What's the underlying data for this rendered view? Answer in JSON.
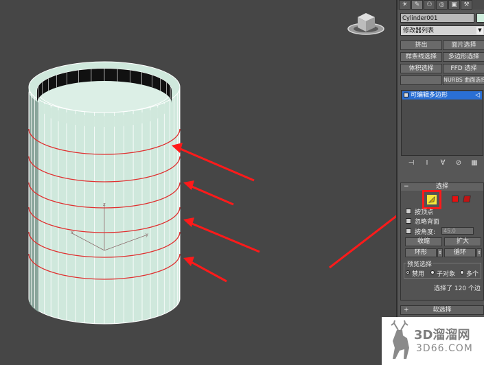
{
  "colors": {
    "viewport_bg": "#464646",
    "mesh": "#cfe8dc",
    "mesh_edges": "#ffffff",
    "selected_edge": "#e03030",
    "arrow": "#ff1a1a",
    "stack_highlight": "#2a6fd4"
  },
  "command_panel": {
    "tabs": [
      {
        "icon": "sun-icon"
      },
      {
        "icon": "modify-brush-icon"
      },
      {
        "icon": "hierarchy-icon"
      },
      {
        "icon": "motion-icon"
      },
      {
        "icon": "display-icon"
      },
      {
        "icon": "utilities-icon"
      }
    ],
    "object_name": "Cylinder001",
    "modifier_list_label": "修改器列表",
    "modifier_buttons": [
      "挤出",
      "面片选择",
      "样条线选择",
      "多边形选择",
      "体积选择",
      "FFD 选择",
      "",
      "NURBS 曲面选择"
    ],
    "stack_item": "可编辑多边形"
  },
  "selection_rollout": {
    "title": "选择",
    "by_vertex": "按顶点",
    "ignore_backfacing": "忽略背面",
    "by_angle": "按角度:",
    "angle_value": "45.0",
    "shrink": "收缩",
    "grow": "扩大",
    "ring": "环形",
    "loop": "循环",
    "preview_group": "预览选择",
    "preview_options": [
      "禁用",
      "子对象",
      "多个"
    ],
    "status": "选择了 120 个边"
  },
  "soft_selection_rollout": {
    "title": "软选择"
  },
  "watermark": {
    "brand": "3D溜溜网",
    "url": "3D66.COM"
  }
}
